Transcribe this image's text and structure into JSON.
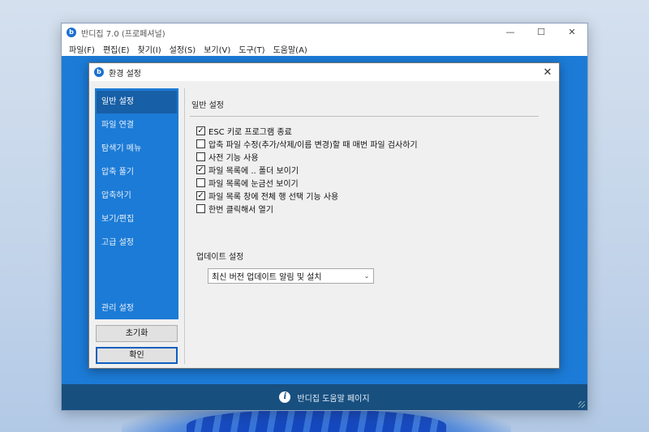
{
  "main_window": {
    "title": "반디집 7.0 (프로페셔널)",
    "controls": {
      "minimize": "—",
      "maximize": "☐",
      "close": "✕"
    },
    "menu": [
      "파일(F)",
      "편집(E)",
      "찾기(I)",
      "설정(S)",
      "보기(V)",
      "도구(T)",
      "도움말(A)"
    ],
    "status": "반디집 도움말 페이지"
  },
  "dialog": {
    "title": "환경 설정",
    "close": "✕",
    "sidebar": [
      "일반 설정",
      "파일 연결",
      "탐색기 메뉴",
      "압축 풀기",
      "압축하기",
      "보기/편집",
      "고급 설정"
    ],
    "sidebar_bottom": "관리 설정",
    "buttons": {
      "reset": "초기화",
      "ok": "확인"
    },
    "panel": {
      "title": "일반 설정",
      "options": [
        {
          "label": "ESC 키로 프로그램 종료",
          "checked": true
        },
        {
          "label": "압축 파일 수정(추가/삭제/이름 변경)할 때 매번 파일 검사하기",
          "checked": false
        },
        {
          "label": "사전 기능 사용",
          "checked": false
        },
        {
          "label": "파일 목록에 .. 폴더 보이기",
          "checked": true
        },
        {
          "label": "파일 목록에 눈금선 보이기",
          "checked": false
        },
        {
          "label": "파일 목록 창에 전체 행 선택 기능 사용",
          "checked": true
        },
        {
          "label": "한번 클릭해서 열기",
          "checked": false
        }
      ],
      "update_group": "업데이트 설정",
      "update_select": "최신 버전 업데이트 알림 및 설치"
    }
  },
  "colors": {
    "accent": "#1c7bd6",
    "status_bar": "#174f7f"
  }
}
